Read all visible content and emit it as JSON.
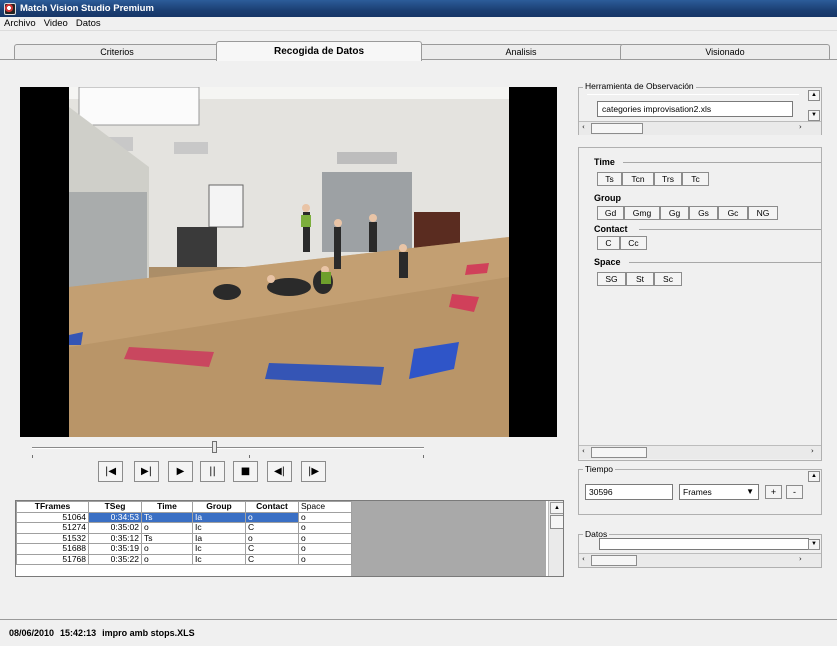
{
  "window": {
    "title": "Match Vision Studio Premium"
  },
  "menu": [
    "Archivo",
    "Video",
    "Datos"
  ],
  "tabs": [
    {
      "label": "Criterios",
      "active": false
    },
    {
      "label": "Recogida de Datos",
      "active": true
    },
    {
      "label": "Analisis",
      "active": false
    },
    {
      "label": "Visionado",
      "active": false
    }
  ],
  "video": {
    "icon": "video-frame-dance-studio"
  },
  "transport": [
    {
      "name": "first-frame-button",
      "glyph": "⏮"
    },
    {
      "name": "next-mark-button",
      "glyph": "▶|"
    },
    {
      "name": "play-button",
      "glyph": "▶"
    },
    {
      "name": "pause-button",
      "glyph": "||"
    },
    {
      "name": "stop-button",
      "glyph": "■"
    },
    {
      "name": "step-back-button",
      "glyph": "◀|"
    },
    {
      "name": "step-forward-button",
      "glyph": "|▶"
    }
  ],
  "table": {
    "columns": [
      "TFrames",
      "TSeg",
      "Time",
      "Group",
      "Contact",
      "Space"
    ],
    "rows": [
      [
        "51064",
        "0:34:53",
        "Ts",
        "Ia",
        "o",
        "o"
      ],
      [
        "51274",
        "0:35:02",
        "o",
        "Ic",
        "C",
        "o"
      ],
      [
        "51532",
        "0:35:12",
        "Ts",
        "Ia",
        "o",
        "o"
      ],
      [
        "51688",
        "0:35:19",
        "o",
        "Ic",
        "C",
        "o"
      ],
      [
        "51768",
        "0:35:22",
        "o",
        "Ic",
        "C",
        "o"
      ]
    ],
    "selected_row": 0
  },
  "observation_tool": {
    "legend": "Herramienta de Observación",
    "value": "categories improvisation2.xls"
  },
  "categories": [
    {
      "title": "Time",
      "buttons": [
        "Ts",
        "Tcn",
        "Trs",
        "Tc"
      ]
    },
    {
      "title": "Group",
      "buttons": [
        "Gd",
        "Gmg",
        "Gg",
        "Gs",
        "Gc",
        "NG"
      ]
    },
    {
      "title": "Contact",
      "buttons": [
        "C",
        "Cc"
      ]
    },
    {
      "title": "Space",
      "buttons": [
        "SG",
        "St",
        "Sc"
      ]
    }
  ],
  "tiempo": {
    "legend": "Tiempo",
    "value": "30596",
    "unit": "Frames",
    "plus": "+",
    "minus": "-"
  },
  "datos": {
    "legend": "Datos",
    "value": ""
  },
  "status": {
    "date": "08/06/2010",
    "time": "15:42:13",
    "file": "impro amb stops.XLS"
  }
}
